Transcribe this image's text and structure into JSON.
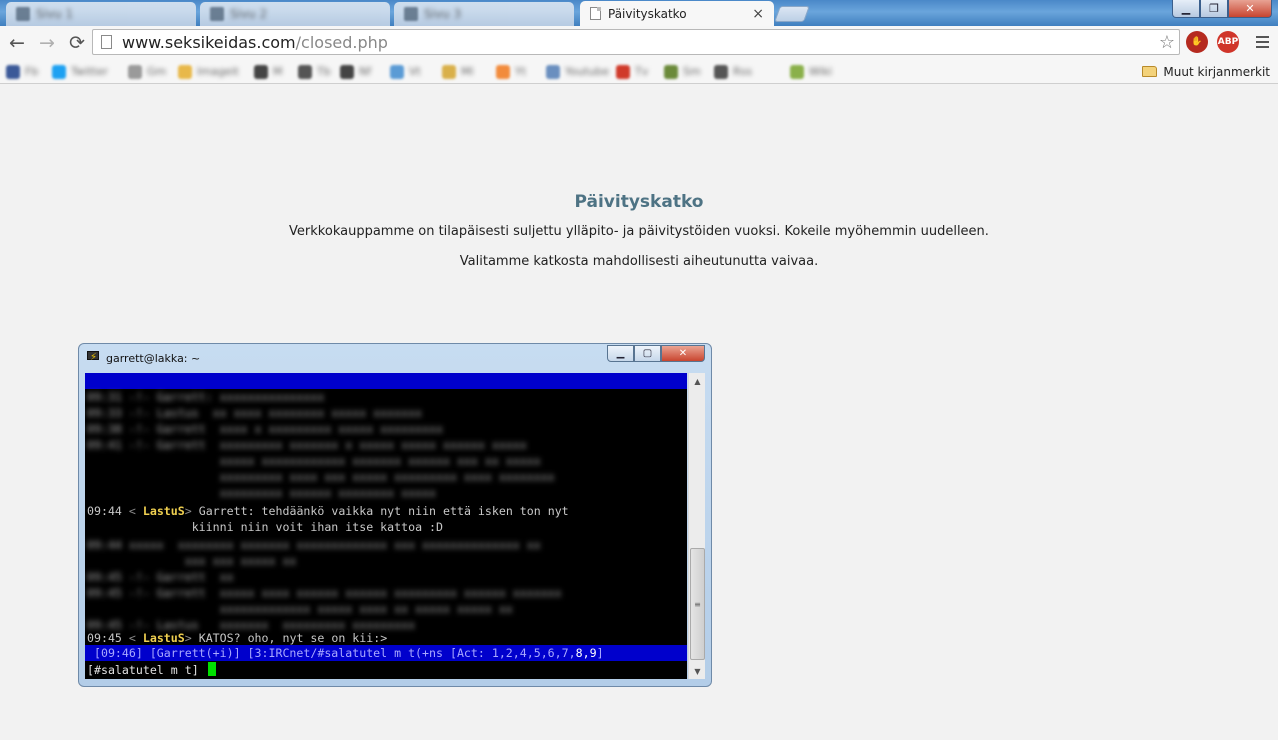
{
  "browser": {
    "active_tab": {
      "title": "Päivityskatko",
      "close": "×"
    },
    "background_tabs": [
      "Sivu 1",
      "Sivu 2",
      "Sivu 3"
    ],
    "url": {
      "host": "www.seksikeidas.com",
      "path": "/closed.php"
    },
    "nav": {
      "back": "←",
      "forward": "→",
      "reload": "⟳",
      "star": "☆"
    },
    "window_buttons": {
      "minimize": "▁",
      "maximize": "❐",
      "close": "✕"
    },
    "extensions": {
      "ublock": "✋",
      "abp": "ABP"
    },
    "bookmarks": {
      "items": [
        "Fb",
        "Twitter",
        "Gm",
        "Imageit",
        "M",
        "Tb",
        "Nf",
        "Vt",
        "Ml",
        "Yt",
        "Youtube",
        "Tv",
        "Sm",
        "Rss",
        "Wiki"
      ],
      "other": "Muut kirjanmerkit"
    }
  },
  "page": {
    "title": "Päivityskatko",
    "line1": "Verkkokauppamme on tilapäisesti suljettu ylläpito- ja päivitystöiden vuoksi. Kokeile myöhemmin uudelleen.",
    "line2": "Valitamme katkosta mahdollisesti aiheutunutta vaivaa."
  },
  "putty": {
    "title": "garrett@lakka: ~",
    "buttons": {
      "minimize": "▁",
      "maximize": "▢",
      "close": "✕"
    },
    "blurred_top": [
      "09:31 -!- Garrett: xxxxxxxxxxxxxxx",
      "09:33 -!- Lastus  xx xxxx xxxxxxxx xxxxx xxxxxxx",
      "09:38 -!- Garrett  xxxx x xxxxxxxxx xxxxx xxxxxxxxx",
      "09:41 -!- Garrett  xxxxxxxxx xxxxxxx x xxxxx xxxxx xxxxxx xxxxx",
      "                   xxxxx xxxxxxxxxxxx xxxxxxx xxxxxx xxx xx xxxxx",
      "                   xxxxxxxxx xxxx xxx xxxxx xxxxxxxxx xxxx xxxxxxxx",
      "                   xxxxxxxxx xxxxxx xxxxxxxx xxxxx"
    ],
    "msg1": {
      "time": "09:44",
      "nick": "LastuS",
      "text1": "Garrett: tehdäänkö vaikka nyt niin että isken ton nyt",
      "text2": "kiinni niin voit ihan itse kattoa :D"
    },
    "blurred_mid": [
      "09:44 xxxxx  xxxxxxxx xxxxxxx xxxxxxxxxxxxx xxx xxxxxxxxxxxxxx xx",
      "              xxx xxx xxxxx xx",
      "09:45 -!- Garrett  xx",
      "09:45 -!- Garrett  xxxxx xxxx xxxxxx xxxxxx xxxxxxxxx xxxxxx xxxxxxx",
      "                   xxxxxxxxxxxxx xxxxx xxxx xx xxxxx xxxxx xx",
      "09:45 -!- Lastus   xxxxxxx  xxxxxxxxx xxxxxxxxx"
    ],
    "msg2": {
      "time": "09:45",
      "nick": "LastuS",
      "text": "KATOS? oho, nyt se on kii:>"
    },
    "status": {
      "part1": " [09:46] [Garrett(+i)] [3:IRCnet/#salatutel m t(+ns [Act: 1,2,4,5,6,7,",
      "part2": "8,9",
      "part3": "]"
    },
    "input": "[#salatutel m t]",
    "scroll": {
      "up": "▲",
      "down": "▼",
      "grip": "≡"
    }
  }
}
